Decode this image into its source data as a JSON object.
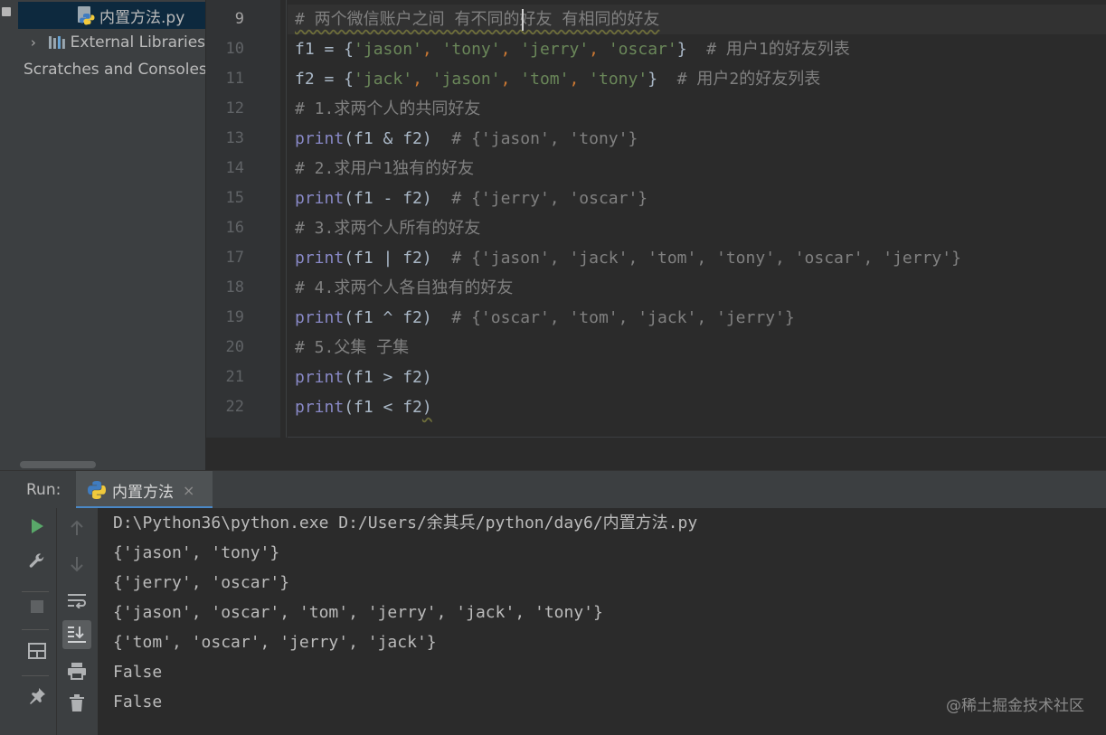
{
  "project_tree": {
    "items": [
      {
        "label": "内置方法.py",
        "icon": "python-file-icon",
        "selected": true
      },
      {
        "label": "External Libraries",
        "icon": "library-icon",
        "expander": "›"
      },
      {
        "label": "Scratches and Consoles",
        "icon": "scratches-icon"
      }
    ]
  },
  "editor": {
    "line_numbers": [
      "9",
      "10",
      "11",
      "12",
      "13",
      "14",
      "15",
      "16",
      "17",
      "18",
      "19",
      "20",
      "21",
      "22"
    ],
    "lines": {
      "l9": {
        "comment": "# 两个微信账户之间 有不同的好友 有相同的好友"
      },
      "l10": {
        "a": "f1 = {",
        "s1": "'jason'",
        "c1": ", ",
        "s2": "'tony'",
        "c2": ", ",
        "s3": "'jerry'",
        "c3": ", ",
        "s4": "'oscar'",
        "b": "}  ",
        "comment": "# 用户1的好友列表"
      },
      "l11": {
        "a": "f2 = {",
        "s1": "'jack'",
        "c1": ", ",
        "s2": "'jason'",
        "c2": ", ",
        "s3": "'tom'",
        "c3": ", ",
        "s4": "'tony'",
        "b": "}  ",
        "comment": "# 用户2的好友列表"
      },
      "l12": {
        "comment": "# 1.求两个人的共同好友"
      },
      "l13": {
        "fn": "print",
        "args": "(f1 & f2)  ",
        "comment": "# {'jason', 'tony'}"
      },
      "l14": {
        "comment": "# 2.求用户1独有的好友"
      },
      "l15": {
        "fn": "print",
        "args": "(f1 - f2)  ",
        "comment": "# {'jerry', 'oscar'}"
      },
      "l16": {
        "comment": "# 3.求两个人所有的好友"
      },
      "l17": {
        "fn": "print",
        "args": "(f1 | f2)  ",
        "comment": "# {'jason', 'jack', 'tom', 'tony', 'oscar', 'jerry'}"
      },
      "l18": {
        "comment": "# 4.求两个人各自独有的好友"
      },
      "l19": {
        "fn": "print",
        "args": "(f1 ^ f2)  ",
        "comment": "# {'oscar', 'tom', 'jack', 'jerry'}"
      },
      "l20": {
        "comment": "# 5.父集 子集"
      },
      "l21": {
        "fn": "print",
        "args": "(f1 > f2)"
      },
      "l22": {
        "fn": "print",
        "args": "(f1 < f2",
        "close": ")"
      }
    }
  },
  "run_panel": {
    "title": "Run:",
    "tab_label": "内置方法",
    "tab_close": "×",
    "output": [
      "D:\\Python36\\python.exe D:/Users/余其兵/python/day6/内置方法.py",
      "{'jason', 'tony'}",
      "{'jerry', 'oscar'}",
      "{'jason', 'oscar', 'tom', 'jerry', 'jack', 'tony'}",
      "{'tom', 'oscar', 'jerry', 'jack'}",
      "False",
      "False"
    ],
    "toolbar_icons": [
      "run-icon",
      "wrench-icon",
      "stop-icon",
      "layout-icon",
      "pin-icon",
      "up-arrow-icon",
      "down-arrow-icon",
      "soft-wrap-icon",
      "scroll-to-end-icon",
      "print-icon",
      "trash-icon"
    ]
  },
  "watermark": "@稀土掘金技术社区",
  "colors": {
    "comment": "#808080",
    "string": "#6a8759",
    "keyword": "#cc7832",
    "builtin": "#8888c6",
    "selection": "#0d293e",
    "accent": "#4a88c7"
  }
}
